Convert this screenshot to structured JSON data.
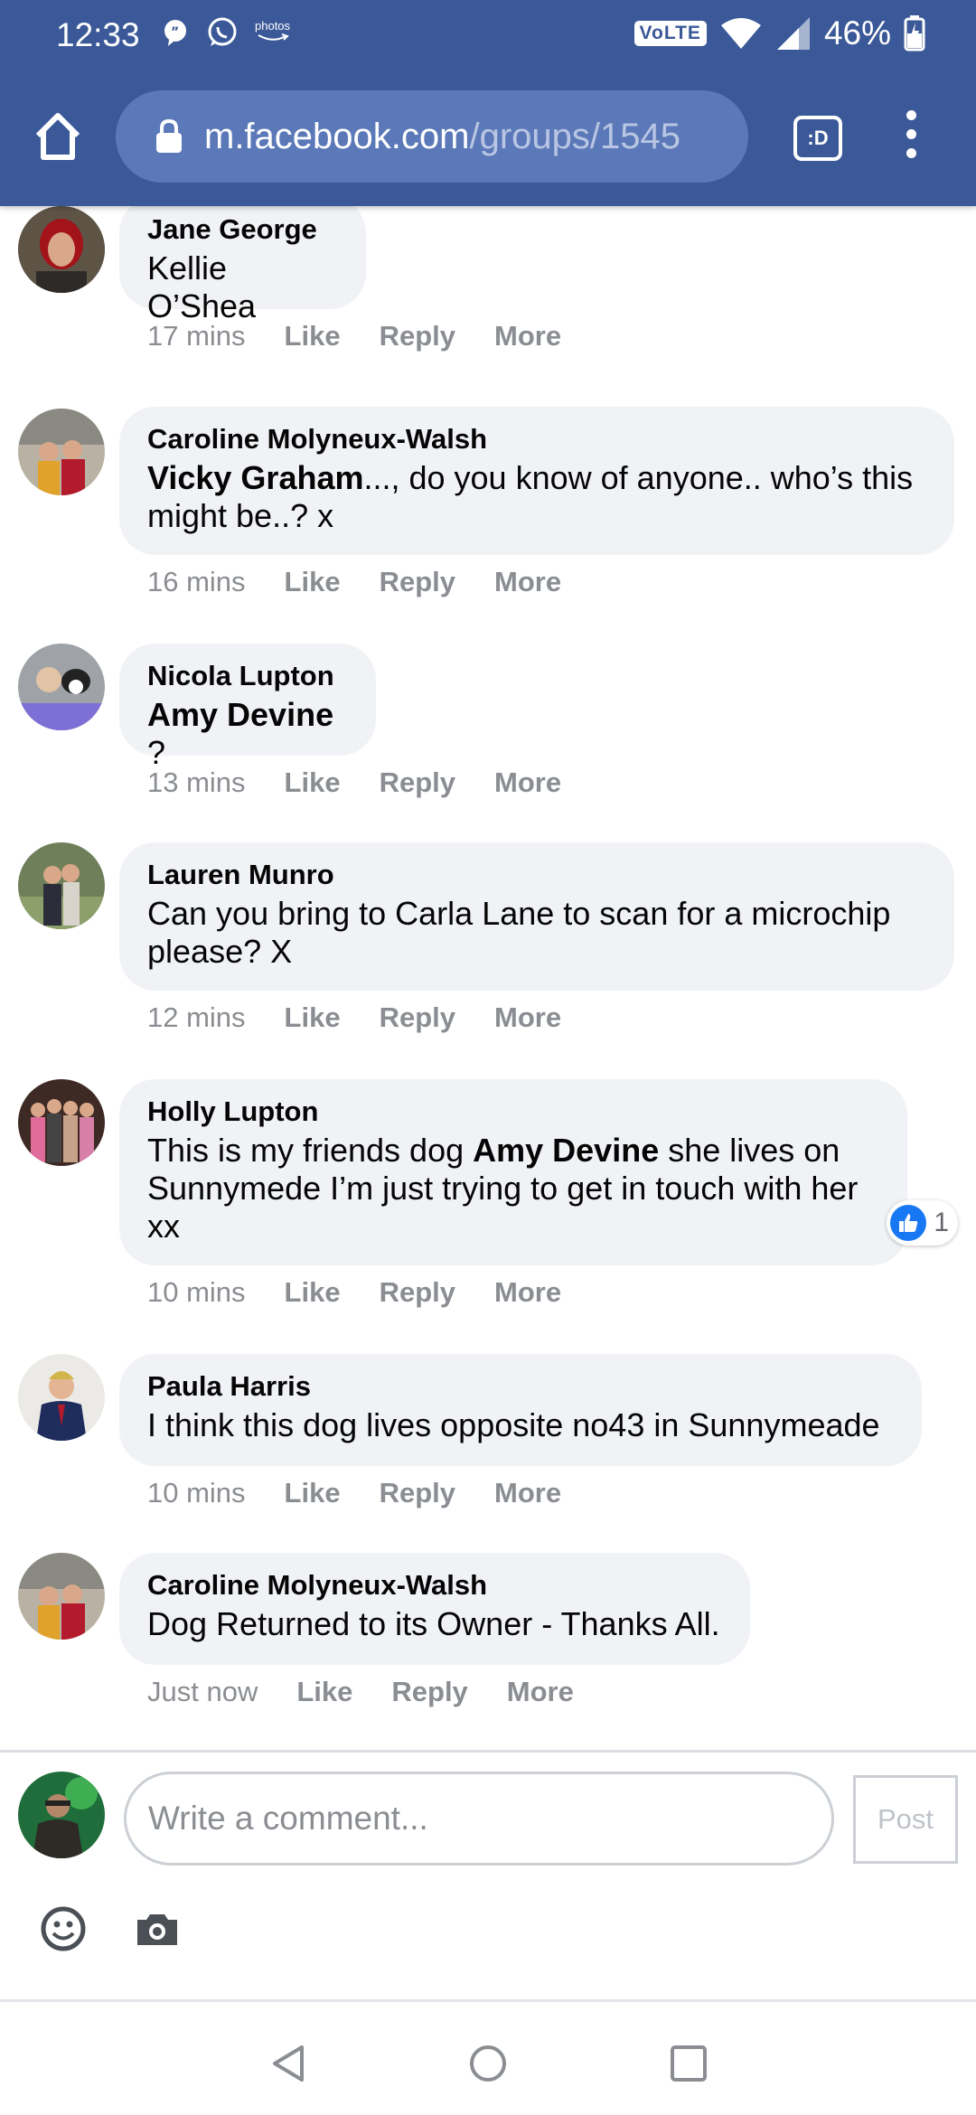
{
  "status_bar": {
    "time": "12:33",
    "photos_label": "photos",
    "volte": "VoLTE",
    "battery": "46%"
  },
  "browser": {
    "url_host": "m.facebook.com",
    "url_path": "/groups/1545",
    "tabs_label": ":D"
  },
  "comments": [
    {
      "author": "Jane George",
      "text_parts": [
        {
          "t": "Kellie O’Shea",
          "b": false
        }
      ],
      "time": "17 mins"
    },
    {
      "author": "Caroline Molyneux-Walsh",
      "text_parts": [
        {
          "t": "Vicky Graham",
          "b": true
        },
        {
          "t": "..., do you know of anyone.. who’s this might be..? x",
          "b": false
        }
      ],
      "time": "16 mins"
    },
    {
      "author": "Nicola Lupton",
      "text_parts": [
        {
          "t": "Amy Devine",
          "b": true
        },
        {
          "t": " ?",
          "b": false
        }
      ],
      "time": "13 mins"
    },
    {
      "author": "Lauren Munro",
      "text_parts": [
        {
          "t": "Can you bring to Carla Lane to scan for a microchip please? X",
          "b": false
        }
      ],
      "time": "12 mins"
    },
    {
      "author": "Holly Lupton",
      "text_parts": [
        {
          "t": "This is my friends dog ",
          "b": false
        },
        {
          "t": "Amy Devine",
          "b": true
        },
        {
          "t": " she lives on Sunnymede I’m just trying to get in touch with her xx",
          "b": false
        }
      ],
      "time": "10 mins",
      "reaction_count": "1"
    },
    {
      "author": "Paula Harris",
      "text_parts": [
        {
          "t": "I think this dog lives opposite no43 in Sunnymeade",
          "b": false
        }
      ],
      "time": "10 mins"
    },
    {
      "author": "Caroline Molyneux-Walsh",
      "text_parts": [
        {
          "t": "Dog Returned to its Owner - Thanks All.",
          "b": false
        }
      ],
      "time": "Just now"
    }
  ],
  "actions": {
    "like": "Like",
    "reply": "Reply",
    "more": "More"
  },
  "composer": {
    "placeholder": "Write a comment...",
    "post": "Post"
  },
  "colors": {
    "brand_bar": "#3b5998",
    "bubble": "#f0f2f5",
    "meta_text": "#8a8d91",
    "like_blue": "#1877f2"
  }
}
